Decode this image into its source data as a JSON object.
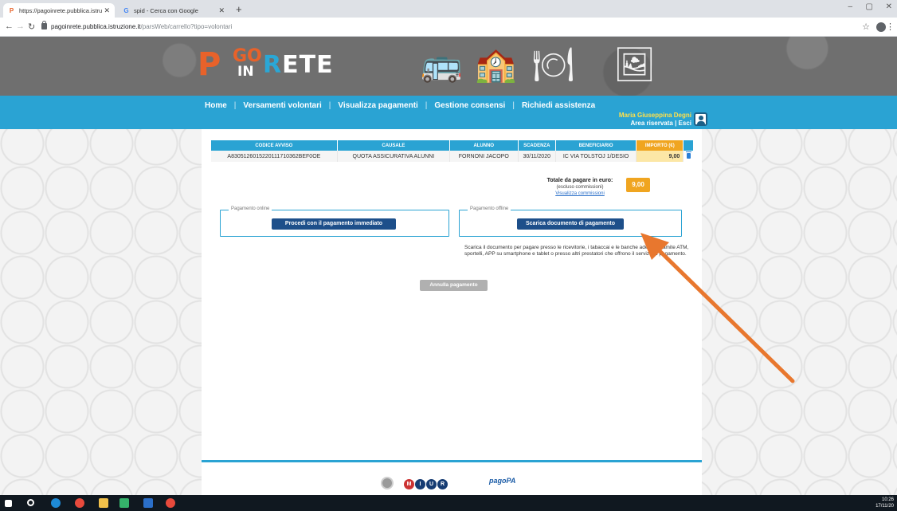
{
  "browser": {
    "tabs": [
      {
        "favicon": "P",
        "title": "https://pagoinrete.pubblica.istru",
        "active": true
      },
      {
        "favicon": "G",
        "title": "spid - Cerca con Google",
        "active": false
      }
    ],
    "url_host": "pagoinrete.pubblica.istruzione.it",
    "url_path": "/parsWeb/carrello?tipo=volontari"
  },
  "site": {
    "logo": {
      "p": "P",
      "go": "GO",
      "in": "IN",
      "rete_r": "R",
      "rete_rest": "ETE"
    },
    "nav": [
      "Home",
      "Versamenti volontari",
      "Visualizza pagamenti",
      "Gestione consensi",
      "Richiedi assistenza"
    ],
    "user_name": "Maria Giuseppina Degni",
    "area_label": "Area riservata | Esci"
  },
  "cart": {
    "headers": [
      "CODICE AVVISO",
      "CAUSALE",
      "ALUNNO",
      "SCADENZA",
      "BENEFICIARIO",
      "IMPORTO (€)"
    ],
    "rows": [
      [
        "A8305126015220111710362BEF0OE",
        "QUOTA ASSICURATIVA ALUNNI",
        "FORNONI JACOPO",
        "30/11/2020",
        "IC VIA TOLSTOJ 1/DESIO",
        "9,00"
      ]
    ],
    "total_label": "Totale da pagare in euro:",
    "total_note": "(escluso commissioni)",
    "total_link": "Visualizza commissioni",
    "total_value": "9,00"
  },
  "payment": {
    "online_legend": "Pagamento online",
    "online_button": "Procedi con il pagamento immediato",
    "offline_legend": "Pagamento offline",
    "offline_button": "Scarica documento di pagamento",
    "offline_text": "Scarica il documento per pagare presso le ricevitorie, i tabaccai e le banche aderenti tramite ATM, sportelli, APP su smartphone e tablet o presso altri prestatori che offrono il servizio a pagamento.",
    "cancel_button": "Annulla pagamento"
  },
  "footer": {
    "miur_letters": [
      "M",
      "I",
      "U",
      "R"
    ],
    "pagopa": "pagoPA"
  },
  "taskbar": {
    "time": "10:26",
    "date": "17/11/20"
  },
  "colors": {
    "nav_blue": "#2aa3d3",
    "amount_orange": "#f0a520",
    "button_navy": "#1d4f8a",
    "arrow": "#e8772e"
  }
}
